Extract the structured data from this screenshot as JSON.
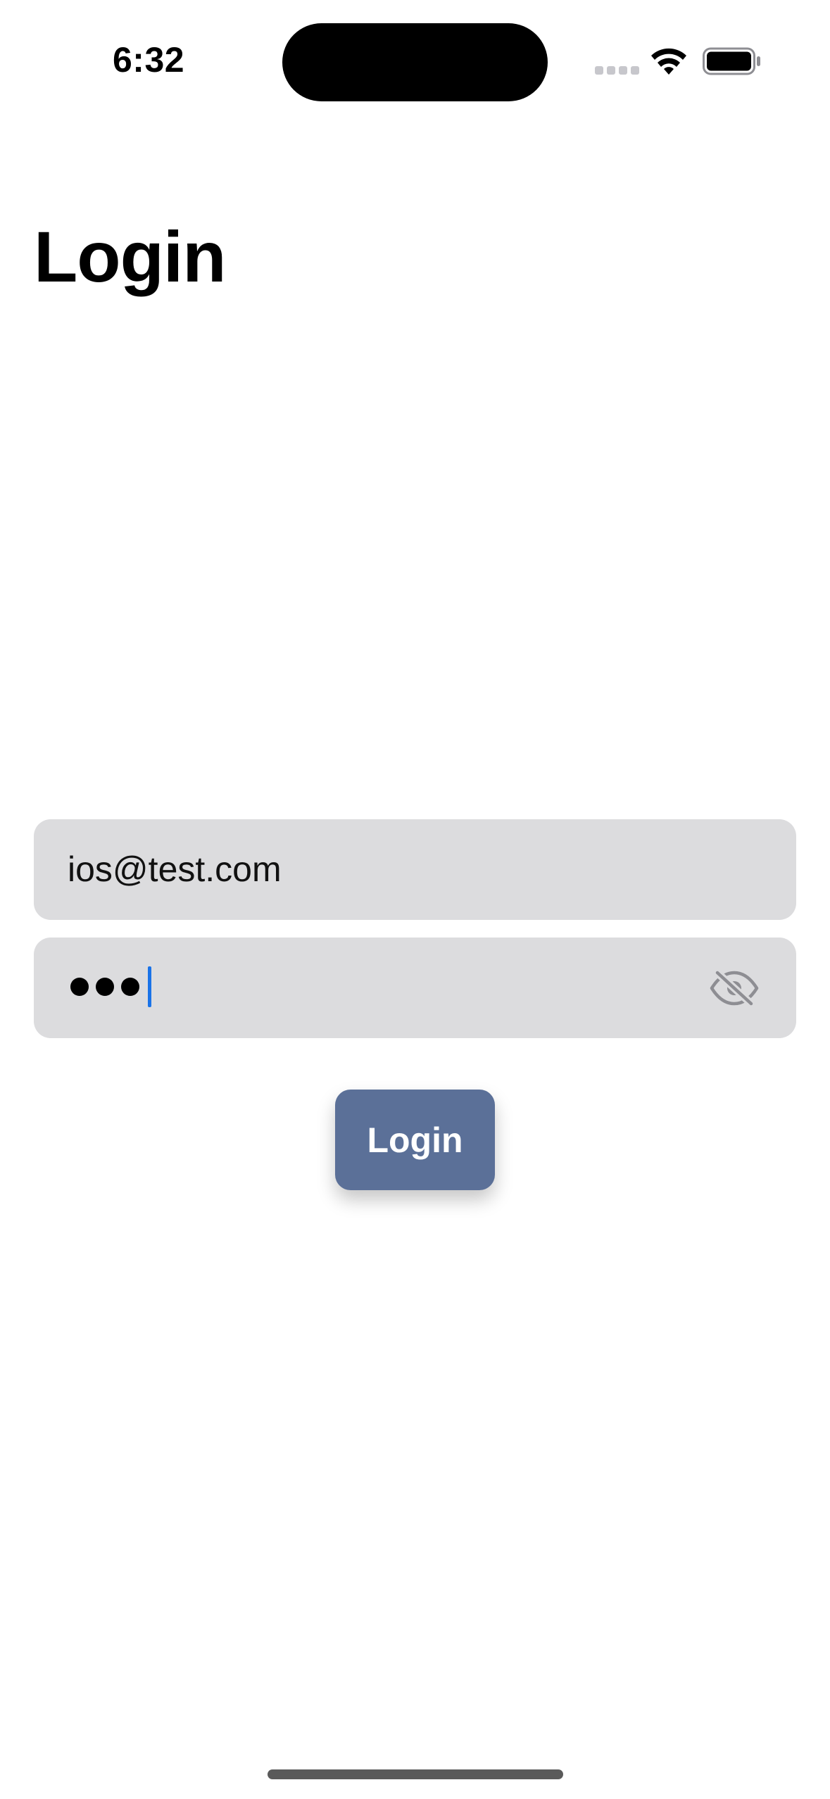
{
  "status_bar": {
    "time": "6:32",
    "icons": [
      "cellular-signal-icon",
      "wifi-icon",
      "battery-icon"
    ]
  },
  "page": {
    "title": "Login"
  },
  "form": {
    "email": {
      "value": "ios@test.com"
    },
    "password": {
      "masked_char_count": 3,
      "show_password_icon": "eye-slash-icon"
    },
    "submit_label": "Login"
  },
  "colors": {
    "field_background": "#dcdcde",
    "button_background": "#5b7098",
    "button_text": "#ffffff",
    "cursor": "#1a73e8"
  }
}
